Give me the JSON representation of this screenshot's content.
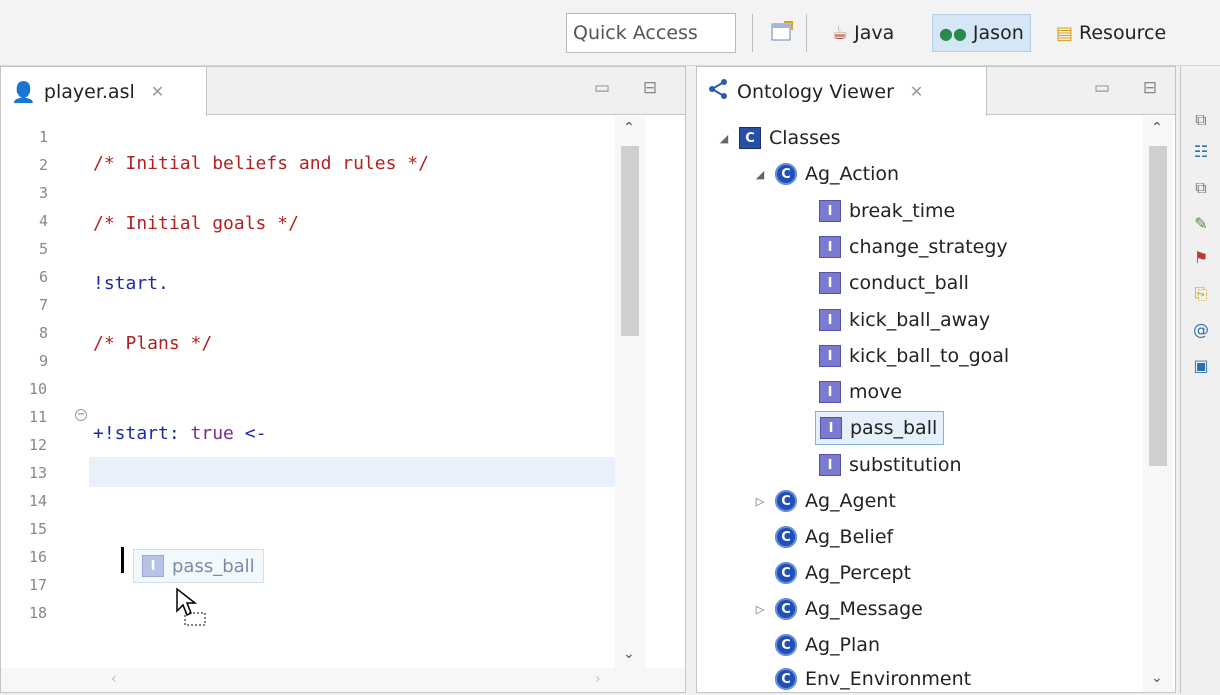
{
  "toolbar": {
    "quick_access_placeholder": "Quick Access",
    "perspectives": [
      {
        "label": "Java",
        "active": false
      },
      {
        "label": "Jason",
        "active": true
      },
      {
        "label": "Resource",
        "active": false
      }
    ]
  },
  "editor": {
    "tab_title": "player.asl",
    "line_numbers": [
      "1",
      "2",
      "3",
      "4",
      "5",
      "6",
      "7",
      "8",
      "9",
      "10",
      "11",
      "12",
      "13",
      "14",
      "15",
      "16",
      "17",
      "18"
    ],
    "lines": {
      "l2": "/* Initial beliefs and rules */",
      "l4": "/* Initial goals */",
      "l6": "!start.",
      "l8": "/* Plans */",
      "l11_plan": "+!start:",
      "l11_true": " true ",
      "l11_arrow": "<-"
    },
    "drag_item": "pass_ball"
  },
  "ontology": {
    "tab_title": "Ontology Viewer",
    "root": "Classes",
    "ag_action": "Ag_Action",
    "individuals": [
      "break_time",
      "change_strategy",
      "conduct_ball",
      "kick_ball_away",
      "kick_ball_to_goal",
      "move",
      "pass_ball",
      "substitution"
    ],
    "selected_individual": "pass_ball",
    "classes": [
      "Ag_Agent",
      "Ag_Belief",
      "Ag_Percept",
      "Ag_Message",
      "Ag_Plan",
      "Env_Environment"
    ]
  }
}
